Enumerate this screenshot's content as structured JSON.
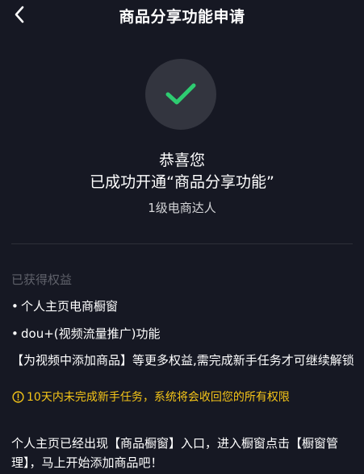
{
  "header": {
    "title": "商品分享功能申请"
  },
  "success": {
    "congrats": "恭喜您",
    "feature_opened": "已成功开通“商品分享功能”",
    "level": "1级电商达人"
  },
  "rights": {
    "title": "已获得权益",
    "items": [
      "个人主页电商橱窗",
      "dou+(视频流量推广)功能"
    ],
    "more": "【为视频中添加商品】等更多权益,需完成新手任务才可继续解锁"
  },
  "warning": {
    "text": "10天内未完成新手任务，系统将会收回您的所有权限"
  },
  "note": {
    "text": "个人主页已经出现【商品橱窗】入口，进入橱窗点击【橱窗管理】，马上开始添加商品吧！"
  },
  "colors": {
    "background": "#161823",
    "check_green": "#2ecc71",
    "warning_yellow": "#f5c518",
    "muted": "#5f616a"
  },
  "icons": {
    "back": "chevron-left-icon",
    "success": "checkmark-icon",
    "warning": "exclamation-circle-icon"
  }
}
